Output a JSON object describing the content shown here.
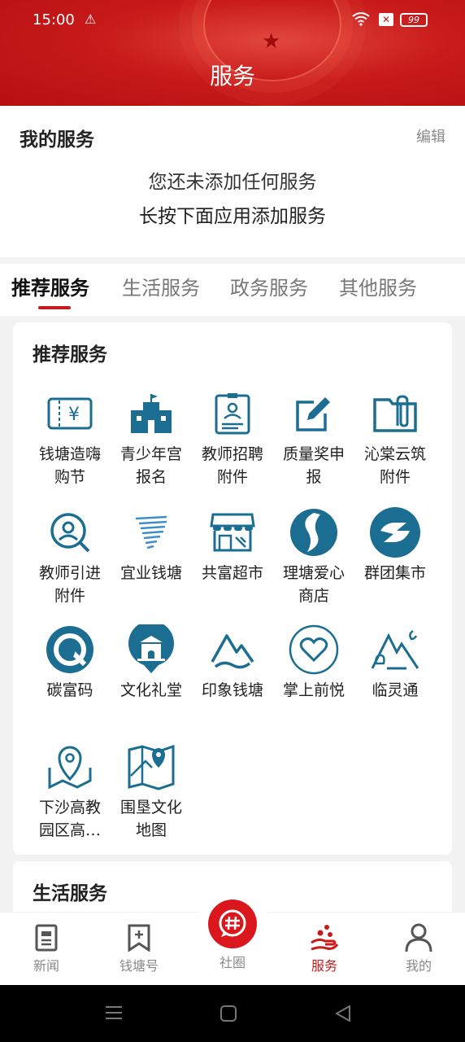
{
  "status_bar": {
    "time": "15:00",
    "battery": "99"
  },
  "header": {
    "title": "服务"
  },
  "my_services": {
    "title": "我的服务",
    "edit": "编辑",
    "empty_line1": "您还未添加任何服务",
    "empty_line2": "长按下面应用添加服务"
  },
  "tabs": [
    "推荐服务",
    "生活服务",
    "政务服务",
    "其他服务"
  ],
  "recommended": {
    "title": "推荐服务",
    "items": [
      {
        "label": "钱塘造嗨购节",
        "icon": "ticket-yen-icon"
      },
      {
        "label": "青少年宫报名",
        "icon": "school-building-icon"
      },
      {
        "label": "教师招聘附件",
        "icon": "id-document-icon"
      },
      {
        "label": "质量奖申报",
        "icon": "edit-square-icon"
      },
      {
        "label": "沁棠云筑附件",
        "icon": "folder-clip-icon"
      },
      {
        "label": "教师引进附件",
        "icon": "person-search-icon"
      },
      {
        "label": "宜业钱塘",
        "icon": "tornado-lines-icon"
      },
      {
        "label": "共富超市",
        "icon": "shop-front-icon"
      },
      {
        "label": "理塘爱心商店",
        "icon": "swirl-logo-icon"
      },
      {
        "label": "群团集市",
        "icon": "s-logo-icon"
      },
      {
        "label": "碳富码",
        "icon": "carbon-q-icon"
      },
      {
        "label": "文化礼堂",
        "icon": "hall-pin-icon"
      },
      {
        "label": "印象钱塘",
        "icon": "mountain-wave-icon"
      },
      {
        "label": "掌上前悦",
        "icon": "heart-circle-icon"
      },
      {
        "label": "临灵通",
        "icon": "mountain-moon-icon"
      },
      {
        "label": "下沙高教园区高…",
        "icon": "map-pin-icon"
      },
      {
        "label": "围垦文化地图",
        "icon": "folded-map-icon"
      }
    ]
  },
  "life_services": {
    "title": "生活服务"
  },
  "bottom_nav": {
    "items": [
      {
        "label": "新闻",
        "icon": "news-icon"
      },
      {
        "label": "钱塘号",
        "icon": "bookmark-plus-icon"
      },
      {
        "label": "社圈",
        "icon": "hashtag-chat-icon"
      },
      {
        "label": "服务",
        "icon": "service-hand-icon"
      },
      {
        "label": "我的",
        "icon": "user-icon"
      }
    ]
  },
  "colors": {
    "brand_red": "#c81a1a",
    "icon_blue": "#1b6e92"
  }
}
